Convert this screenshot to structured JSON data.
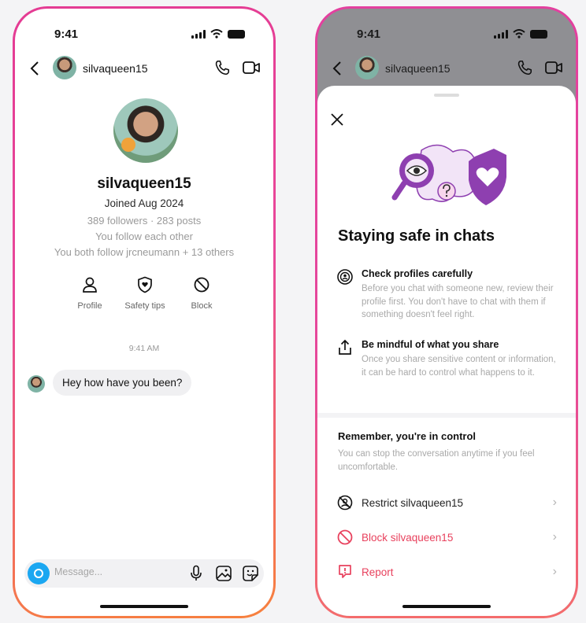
{
  "status_time": "9:41",
  "chat": {
    "username": "silvaqueen15",
    "joined": "Joined Aug 2024",
    "stats": "389 followers · 283 posts",
    "follow_status": "You follow each other",
    "mutual": "You both follow jrcneumann + 13 others",
    "actions": {
      "profile": "Profile",
      "safety_tips": "Safety tips",
      "block": "Block"
    },
    "timestamp": "9:41 AM",
    "message": "Hey how have you been?",
    "composer_placeholder": "Message..."
  },
  "sheet": {
    "title": "Staying safe in chats",
    "tips": [
      {
        "heading": "Check profiles carefully",
        "body": "Before you chat with someone new, review their profile first. You don't have to chat with them if something doesn't feel right."
      },
      {
        "heading": "Be mindful of what you share",
        "body": "Once you share sensitive content or information, it can be hard to control what happens to it."
      }
    ],
    "control_title": "Remember, you're in control",
    "control_body": "You can stop the conversation anytime if you feel uncomfortable.",
    "rows": {
      "restrict": "Restrict silvaqueen15",
      "block": "Block silvaqueen15",
      "report": "Report"
    }
  },
  "colors": {
    "accent": "#e8415d",
    "camera": "#1ba7f1",
    "illustration": "#8e3fb0",
    "border": "#e43b93"
  }
}
